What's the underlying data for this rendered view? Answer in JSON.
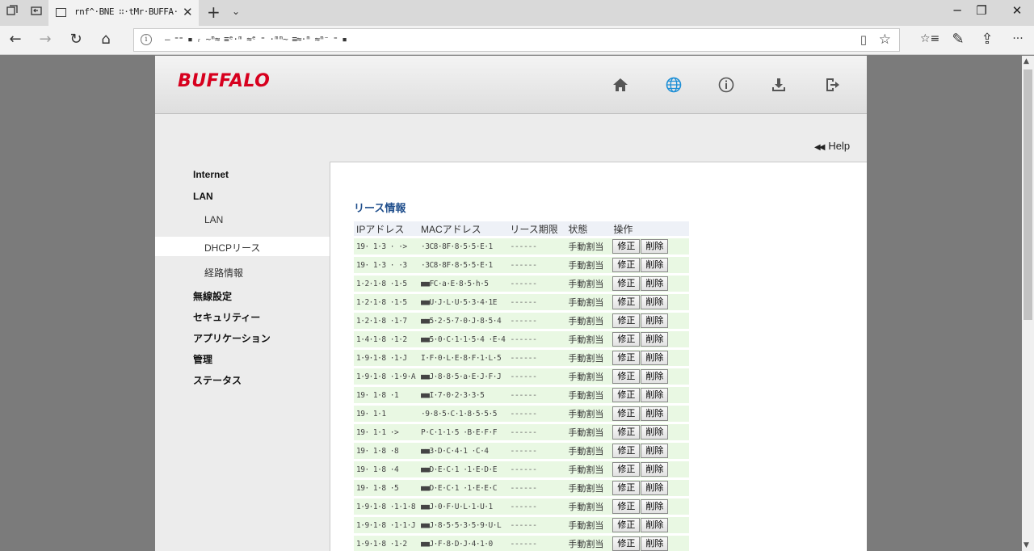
{
  "browser": {
    "tab_title": "rnf^·BNE ∷·tMr·BUFFA·",
    "url": "— ⁼⁼ ▪ ᵣ ~ᵐ≈ ≡ᵉ·ᵐ ≈ᵉ ⁼ ·ᵐᵐ~ ≡≈·ᵐ ≈ᵐ⁻ ⁼ ▪",
    "icons": {
      "tab_overview": "tab-overview-icon",
      "set_aside": "set-aside-icon",
      "new_tab": "+",
      "tab_menu": "⌄",
      "back": "←",
      "forward": "→",
      "refresh": "↻",
      "home": "⌂",
      "minimize": "─",
      "restore": "❐",
      "close": "✕",
      "close_tab": "✕",
      "reading_view": "▯",
      "favorite": "☆",
      "favorites_hub": "☆≡",
      "notes": "✎",
      "share": "⇪",
      "more": "···"
    }
  },
  "router": {
    "logo": "BUFFALO",
    "help_label": "Help",
    "nav": {
      "internet": "Internet",
      "lan": "LAN",
      "lan_sub": "LAN",
      "dhcp_sub": "DHCPリース",
      "route_sub": "経路情報",
      "wireless": "無線設定",
      "security": "セキュリティー",
      "applications": "アプリケーション",
      "admin": "管理",
      "status": "ステータス"
    },
    "section_title": "リース情報",
    "columns": {
      "ip": "IPアドレス",
      "mac": "MACアドレス",
      "expiry": "リース期限",
      "state": "状態",
      "ops": "操作"
    },
    "buttons": {
      "edit": "修正",
      "delete": "削除"
    },
    "leases": [
      {
        "ip": "19· 1·3 · ·>",
        "mac": "·3C8·8F·8·5·5·E·1",
        "expiry": "------",
        "state": "手動割当"
      },
      {
        "ip": "19· 1·3 · ·3",
        "mac": "·3C8·8F·8·5·5·E·1",
        "expiry": "------",
        "state": "手動割当"
      },
      {
        "ip": "1·2·1·8 ·1·5",
        "mac": "■■FC·a·E·8·5·h·5",
        "expiry": "------",
        "state": "手動割当"
      },
      {
        "ip": "1·2·1·8 ·1·5",
        "mac": "■■U·J·L·U·5·3·4·1E",
        "expiry": "------",
        "state": "手動割当"
      },
      {
        "ip": "1·2·1·8 ·1·7",
        "mac": "■■5·2·5·7·0·J·8·5·4",
        "expiry": "------",
        "state": "手動割当"
      },
      {
        "ip": "1·4·1·8 ·1·2",
        "mac": "■■5·0·C·1·1·5·4 ·E·4",
        "expiry": "------",
        "state": "手動割当"
      },
      {
        "ip": "1·9·1·8 ·1·J",
        "mac": "I·F·0·L·E·8·F·1·L·5",
        "expiry": "------",
        "state": "手動割当"
      },
      {
        "ip": "1·9·1·8 ·1·9·A",
        "mac": "■■J·8·8·5·a·E·J·F·J",
        "expiry": "------",
        "state": "手動割当"
      },
      {
        "ip": "19· 1·8 ·1",
        "mac": "■■I·7·0·2·3·3·5",
        "expiry": "------",
        "state": "手動割当"
      },
      {
        "ip": "19· 1·1",
        "mac": "·9·8·5·C·1·8·5·5·5",
        "expiry": "------",
        "state": "手動割当"
      },
      {
        "ip": "19· 1·1 ·>",
        "mac": "P·C·1·1·5 ·B·E·F·F",
        "expiry": "------",
        "state": "手動割当"
      },
      {
        "ip": "19· 1·8 ·8",
        "mac": "■■3·D·C·4·1 ·C·4",
        "expiry": "------",
        "state": "手動割当"
      },
      {
        "ip": "19· 1·8 ·4",
        "mac": "■■D·E·C·1 ·1·E·D·E",
        "expiry": "------",
        "state": "手動割当"
      },
      {
        "ip": "19· 1·8 ·5",
        "mac": "■■D·E·C·1 ·1·E·E·C",
        "expiry": "------",
        "state": "手動割当"
      },
      {
        "ip": "1·9·1·8 ·1·1·8",
        "mac": "■■J·0·F·U·L·1·U·1",
        "expiry": "------",
        "state": "手動割当"
      },
      {
        "ip": "1·9·1·8 ·1·1·J",
        "mac": "■■J·8·5·5·3·5·9·U·L",
        "expiry": "------",
        "state": "手動割当"
      },
      {
        "ip": "1·9·1·8 ·1·2",
        "mac": "■■J·F·8·D·J·4·1·0",
        "expiry": "------",
        "state": "手動割当"
      }
    ],
    "header_icons": [
      "home-icon",
      "globe-icon",
      "info-icon",
      "download-icon",
      "logout-icon"
    ],
    "colors": {
      "logo": "#d7001e",
      "globe_active": "#1e8fd6",
      "section_title": "#1f4e8c",
      "row_bg": "#e9f8e3"
    }
  }
}
